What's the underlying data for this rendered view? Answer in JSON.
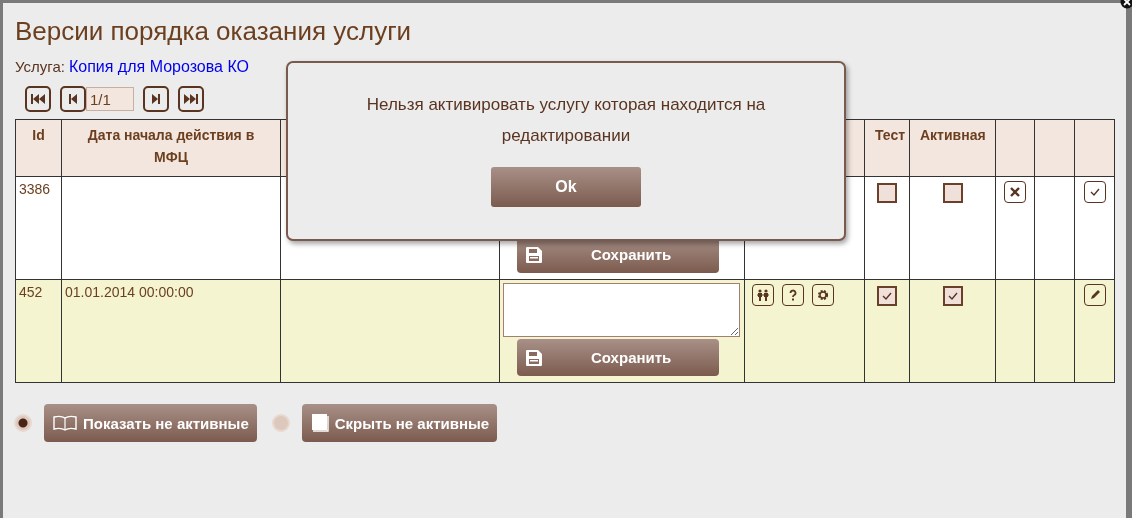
{
  "title": "Версии порядка оказания услуги",
  "service": {
    "label": "Услуга:",
    "link": "Копия для Морозова КО"
  },
  "pager": {
    "page": "1/1"
  },
  "table": {
    "columns": [
      {
        "label": "Id"
      },
      {
        "label": "Дата начала действия в МФЦ"
      },
      {},
      {},
      {},
      {
        "label": "Тест"
      },
      {
        "label": "Активная"
      },
      {},
      {},
      {}
    ],
    "rows": [
      {
        "id": "3386",
        "selected": false,
        "save": "Сохранить",
        "tools": [],
        "test": false,
        "active": false,
        "col8": {
          "kind": "delete"
        },
        "col10": {
          "kind": "confirm"
        }
      },
      {
        "id": "452",
        "date": "01.01.2014 00:00:00",
        "selected": true,
        "comment_field": true,
        "save": "Сохранить",
        "tools": [
          {
            "kind": "people"
          },
          {
            "kind": "help"
          },
          {
            "kind": "settings"
          }
        ],
        "test": true,
        "active": true,
        "col10": {
          "kind": "edit"
        }
      }
    ]
  },
  "filters": [
    {
      "label": "Показать не активные",
      "selected": true,
      "kind": "open-book"
    },
    {
      "label": "Скрыть не активные",
      "selected": false,
      "kind": "closed-book"
    }
  ],
  "dialog": {
    "message": "Нельзя активировать услугу которая находится на редактировании",
    "button": "Ok"
  }
}
